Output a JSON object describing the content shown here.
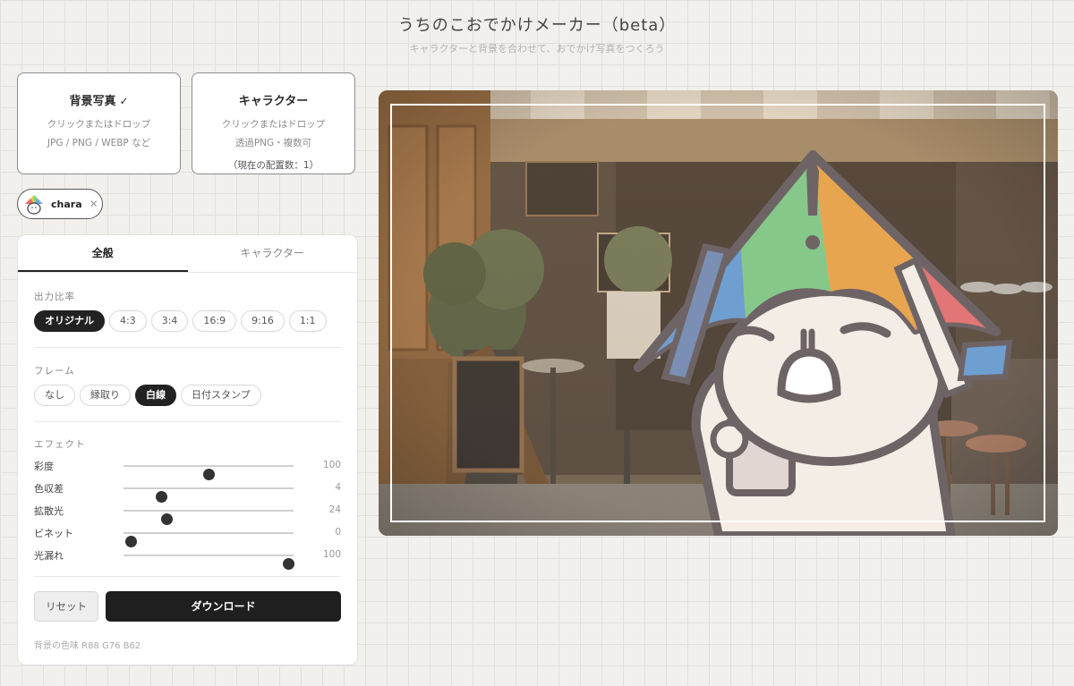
{
  "header": {
    "title": "うちのこおでかけメーカー（beta）",
    "subtitle": "キャラクターと背景を合わせて、おでかけ写真をつくろう"
  },
  "upload_background": {
    "title": "背景写真",
    "check": "✓",
    "line1": "クリックまたはドロップ",
    "line2": "JPG / PNG / WEBP など"
  },
  "upload_character": {
    "title": "キャラクター",
    "line1": "クリックまたはドロップ",
    "line2": "透過PNG・複数可",
    "count": "（現在の配置数：1）"
  },
  "chip": {
    "label": "chara",
    "close": "✕"
  },
  "tabs": [
    {
      "label": "全般",
      "active": true
    },
    {
      "label": "キャラクター",
      "active": false
    }
  ],
  "output_ratio": {
    "label": "出力比率",
    "options": [
      "オリジナル",
      "4:3",
      "3:4",
      "16:9",
      "9:16",
      "1:1"
    ],
    "selected": "オリジナル"
  },
  "frame": {
    "label": "フレーム",
    "options": [
      "なし",
      "縁取り",
      "白線",
      "日付スタンプ"
    ],
    "selected": "白線"
  },
  "effects": {
    "label": "エフェクト",
    "sliders": [
      {
        "label": "彩度",
        "value": "100",
        "fraction": 0.5
      },
      {
        "label": "色収差",
        "value": "4",
        "fraction": 0.22
      },
      {
        "label": "拡散光",
        "value": "24",
        "fraction": 0.25
      },
      {
        "label": "ビネット",
        "value": "0",
        "fraction": 0.04
      },
      {
        "label": "光漏れ",
        "value": "100",
        "fraction": 0.97
      }
    ]
  },
  "buttons": {
    "reset": "リセット",
    "download": "ダウンロード"
  },
  "bg_color_info": "背景の色味 R88 G76 B62",
  "colors": {
    "accent": "#222222",
    "background": "#f1f0ed",
    "frame_line": "#ffffff"
  }
}
